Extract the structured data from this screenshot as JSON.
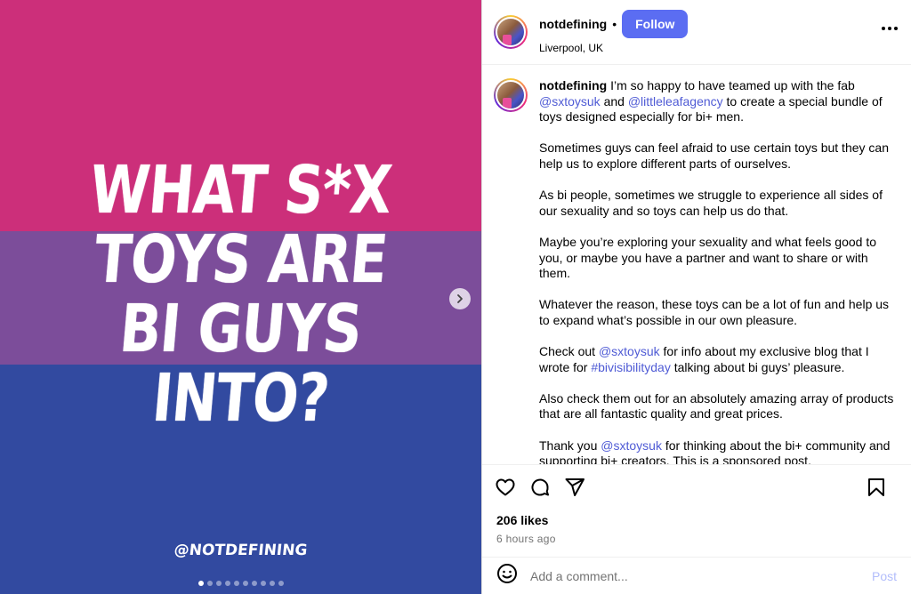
{
  "colors": {
    "pink": "#cc2f7a",
    "purple": "#7c4d9a",
    "blue": "#324aa0",
    "accent": "#5b6df2",
    "mention": "#4f5bd5"
  },
  "media": {
    "headline": [
      "WHAT S*X",
      "TOYS ARE",
      "BI GUYS",
      "INTO?"
    ],
    "handle": "@NOTDEFINING",
    "next_icon": "chevron-right-icon",
    "carousel_count": 10,
    "carousel_active_index": 0
  },
  "header": {
    "username": "notdefining",
    "separator": "•",
    "follow_label": "Follow",
    "location": "Liverpool, UK",
    "more_icon": "more-options-icon"
  },
  "caption": {
    "username": "notdefining",
    "p1": {
      "t1": "I’m so happy to have teamed up with the fab ",
      "m1": "@sxtoysuk",
      "t2": " and ",
      "m2": "@littleleafagency",
      "t3": " to create a special bundle of toys designed especially for bi+ men."
    },
    "p2": "Sometimes guys can feel afraid to use certain toys but they can help us to explore different parts of ourselves.",
    "p3": "As bi people, sometimes we struggle to experience all sides of our sexuality and so toys can help us do that.",
    "p4": "Maybe you’re exploring your sexuality and what feels good to you, or maybe you have a partner and want to share or with them.",
    "p5": "Whatever the reason, these toys can be a lot of fun and help us to expand what’s possible in our own pleasure.",
    "p6": {
      "t1": "Check out ",
      "m1": "@sxtoysuk",
      "t2": " for info about my exclusive blog that I wrote for ",
      "m2": "#bivisibilityday",
      "t3": " talking about bi guys’ pleasure."
    },
    "p7": "Also check them out for an absolutely amazing array of products that are all fantastic quality and great prices.",
    "p8": {
      "t1": "Thank you ",
      "m1": "@sxtoysuk",
      "t2": " for thinking about the bi+ community and supporting bi+ creators. This is a sponsored post."
    }
  },
  "actions": {
    "like_icon": "heart-icon",
    "comment_icon": "comment-icon",
    "share_icon": "share-icon",
    "save_icon": "bookmark-icon",
    "likes": "206 likes",
    "time": "6 hours ago"
  },
  "comment": {
    "emoji_icon": "emoji-icon",
    "placeholder": "Add a comment...",
    "post_label": "Post"
  }
}
